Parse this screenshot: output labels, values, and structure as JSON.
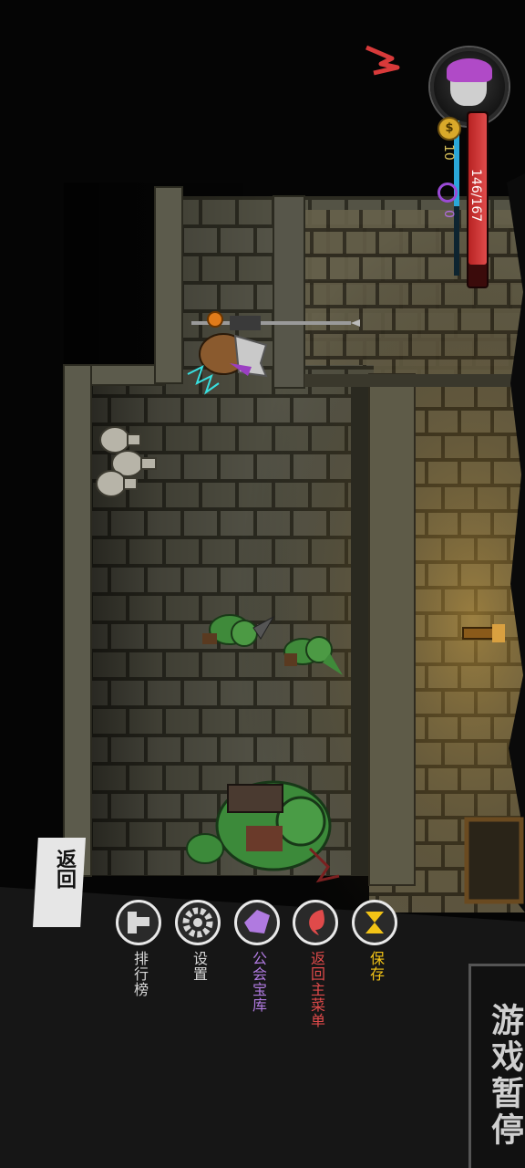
{
  "hud": {
    "hp_text": "146/167",
    "hp_fraction": 0.874,
    "mp_fraction": 0.55,
    "coins": "10",
    "coin_symbol": "$",
    "souls": "0"
  },
  "pause_menu": {
    "title": "游戏暂停",
    "back_label": "返回",
    "items": [
      {
        "label": "保存",
        "color": "#f2c316",
        "icon": "hourglass-icon"
      },
      {
        "label": "返回主菜单",
        "color": "#e04a4a",
        "icon": "return-arrow-icon"
      },
      {
        "label": "公会宝库",
        "color": "#b07ae0",
        "icon": "crystal-icon"
      },
      {
        "label": "设置",
        "color": "#d8d8d8",
        "icon": "gear-icon"
      },
      {
        "label": "排行榜",
        "color": "#d8d8d8",
        "icon": "podium-icon"
      }
    ]
  },
  "colors": {
    "floor": "#4a4838",
    "wall": "#5a5a4a",
    "goblin": "#3f8a3a",
    "panel": "#161616"
  }
}
